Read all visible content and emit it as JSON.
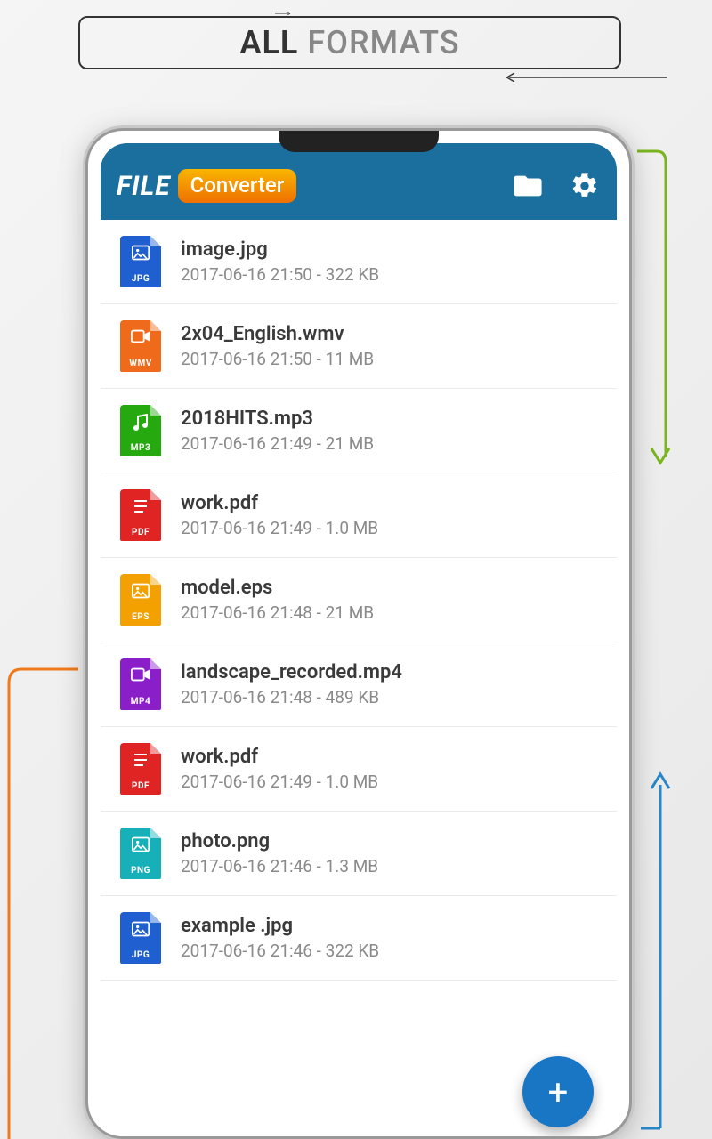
{
  "banner": {
    "word1": "ALL",
    "word2": "FORMATS"
  },
  "app": {
    "logo_text": "FILE",
    "logo_badge": "Converter"
  },
  "colors": {
    "jpg": "#1f5fd0",
    "wmv": "#ef6a1a",
    "mp3": "#26a80f",
    "pdf": "#e02424",
    "eps": "#f2a100",
    "mp4": "#8a1ec9",
    "png": "#17b0b8"
  },
  "files": [
    {
      "name": "image.jpg",
      "sub": "2017-06-16 21:50 - 322 KB",
      "ext": "JPG",
      "type": "image",
      "color": "jpg"
    },
    {
      "name": "2x04_English.wmv",
      "sub": "2017-06-16 21:50 - 11 MB",
      "ext": "WMV",
      "type": "video",
      "color": "wmv"
    },
    {
      "name": "2018HITS.mp3",
      "sub": "2017-06-16 21:49 - 21 MB",
      "ext": "MP3",
      "type": "audio",
      "color": "mp3"
    },
    {
      "name": "work.pdf",
      "sub": "2017-06-16 21:49 - 1.0 MB",
      "ext": "PDF",
      "type": "doc",
      "color": "pdf"
    },
    {
      "name": "model.eps",
      "sub": "2017-06-16 21:48 - 21 MB",
      "ext": "EPS",
      "type": "image",
      "color": "eps"
    },
    {
      "name": "landscape_recorded.mp4",
      "sub": "2017-06-16 21:48 - 489 KB",
      "ext": "MP4",
      "type": "video",
      "color": "mp4"
    },
    {
      "name": "work.pdf",
      "sub": "2017-06-16 21:49 - 1.0 MB",
      "ext": "PDF",
      "type": "doc",
      "color": "pdf"
    },
    {
      "name": "photo.png",
      "sub": "2017-06-16 21:46 - 1.3 MB",
      "ext": "PNG",
      "type": "image",
      "color": "png"
    },
    {
      "name": "example .jpg",
      "sub": "2017-06-16 21:46 - 322 KB",
      "ext": "JPG",
      "type": "image",
      "color": "jpg"
    }
  ],
  "fab": {
    "label": "+"
  }
}
